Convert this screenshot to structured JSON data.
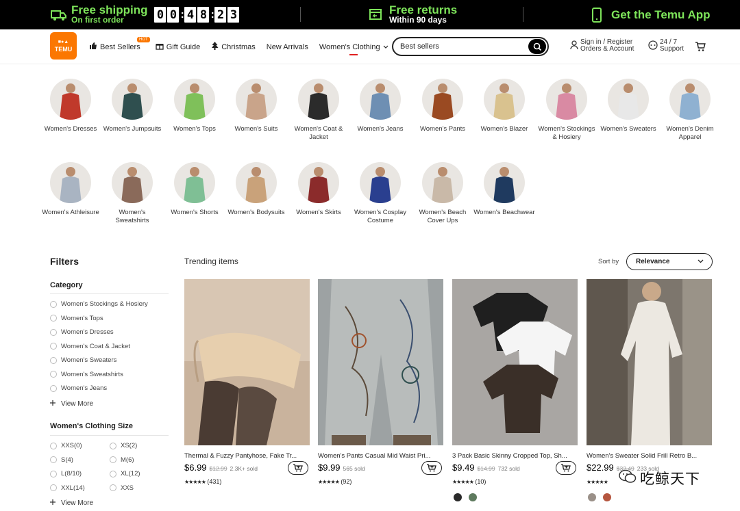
{
  "promo": {
    "shipping_title": "Free shipping",
    "shipping_sub": "On first order",
    "countdown": [
      "0",
      "0",
      "4",
      "8",
      "2",
      "3"
    ],
    "returns_title": "Free returns",
    "returns_sub": "Within 90 days",
    "app_title": "Get the Temu App"
  },
  "header": {
    "logo_text": "TEMU",
    "nav": {
      "best_sellers": "Best Sellers",
      "hot_badge": "HOT",
      "gift_guide": "Gift Guide",
      "christmas": "Christmas",
      "new_arrivals": "New Arrivals",
      "womens_clothing": "Women's Clothing"
    },
    "search_value": "Best sellers",
    "account_line1": "Sign in / Register",
    "account_line2": "Orders & Account",
    "support_line1": "24 / 7",
    "support_line2": "Support"
  },
  "categories": [
    {
      "label": "Women's Dresses",
      "color": "#c0392b"
    },
    {
      "label": "Women's Jumpsuits",
      "color": "#2f4f4f"
    },
    {
      "label": "Women's Tops",
      "color": "#7fc05a"
    },
    {
      "label": "Women's Suits",
      "color": "#c9a48a"
    },
    {
      "label": "Women's Coat & Jacket",
      "color": "#2b2b2b"
    },
    {
      "label": "Women's Jeans",
      "color": "#6e8fb3"
    },
    {
      "label": "Women's Pants",
      "color": "#9a4a22"
    },
    {
      "label": "Women's Blazer",
      "color": "#d9c28f"
    },
    {
      "label": "Women's Stockings & Hosiery",
      "color": "#d98aa3"
    },
    {
      "label": "Women's Sweaters",
      "color": "#e8e8e8"
    },
    {
      "label": "Women's Denim Apparel",
      "color": "#8fb1d1"
    },
    {
      "label": "Women's Athleisure",
      "color": "#a9b4c2"
    },
    {
      "label": "Women's Sweatshirts",
      "color": "#8a6a5a"
    },
    {
      "label": "Women's Shorts",
      "color": "#7fbf95"
    },
    {
      "label": "Women's Bodysuits",
      "color": "#c9a27a"
    },
    {
      "label": "Women's Skirts",
      "color": "#8b2b2b"
    },
    {
      "label": "Women's Cosplay Costume",
      "color": "#2a3f8f"
    },
    {
      "label": "Women's Beach Cover Ups",
      "color": "#c9b9a8"
    },
    {
      "label": "Women's Beachwear",
      "color": "#1f3a5f"
    }
  ],
  "filters": {
    "title": "Filters",
    "category_heading": "Category",
    "category_options": [
      "Women's Stockings & Hosiery",
      "Women's Tops",
      "Women's Dresses",
      "Women's Coat & Jacket",
      "Women's Sweaters",
      "Women's Sweatshirts",
      "Women's Jeans"
    ],
    "view_more": "View More",
    "size_heading": "Women's Clothing Size",
    "size_options": [
      "XXS(0)",
      "XS(2)",
      "S(4)",
      "M(6)",
      "L(8/10)",
      "XL(12)",
      "XXL(14)",
      "XXS"
    ],
    "view_more_2": "View More"
  },
  "listing": {
    "heading": "Trending items",
    "sort_label": "Sort by",
    "sort_value": "Relevance"
  },
  "products": [
    {
      "title": "Thermal & Fuzzy Pantyhose, Fake Tr...",
      "price": "$6.99",
      "orig": "$12.99",
      "sold": "2.3K+ sold",
      "reviews": "(431)",
      "swatches": []
    },
    {
      "title": "Women's Pants Casual Mid Waist Pri...",
      "price": "$9.99",
      "orig": "",
      "sold": "565 sold",
      "reviews": "(92)",
      "swatches": []
    },
    {
      "title": "3 Pack Basic Skinny Cropped Top, Sh...",
      "price": "$9.49",
      "orig": "$14.99",
      "sold": "732 sold",
      "reviews": "(10)",
      "swatches": [
        "#2a2a2a",
        "#5e7a5e"
      ]
    },
    {
      "title": "Women's Sweater Solid Frill Retro B...",
      "price": "$22.99",
      "orig": "$32.49",
      "sold": "233 sold",
      "reviews": "",
      "swatches": [
        "#9a9088",
        "#b5563f"
      ]
    }
  ],
  "watermark": "吃鲸天下",
  "colors": {
    "brand": "#fb7701",
    "promo_green": "#7de35a",
    "hot_red": "#e02020"
  }
}
